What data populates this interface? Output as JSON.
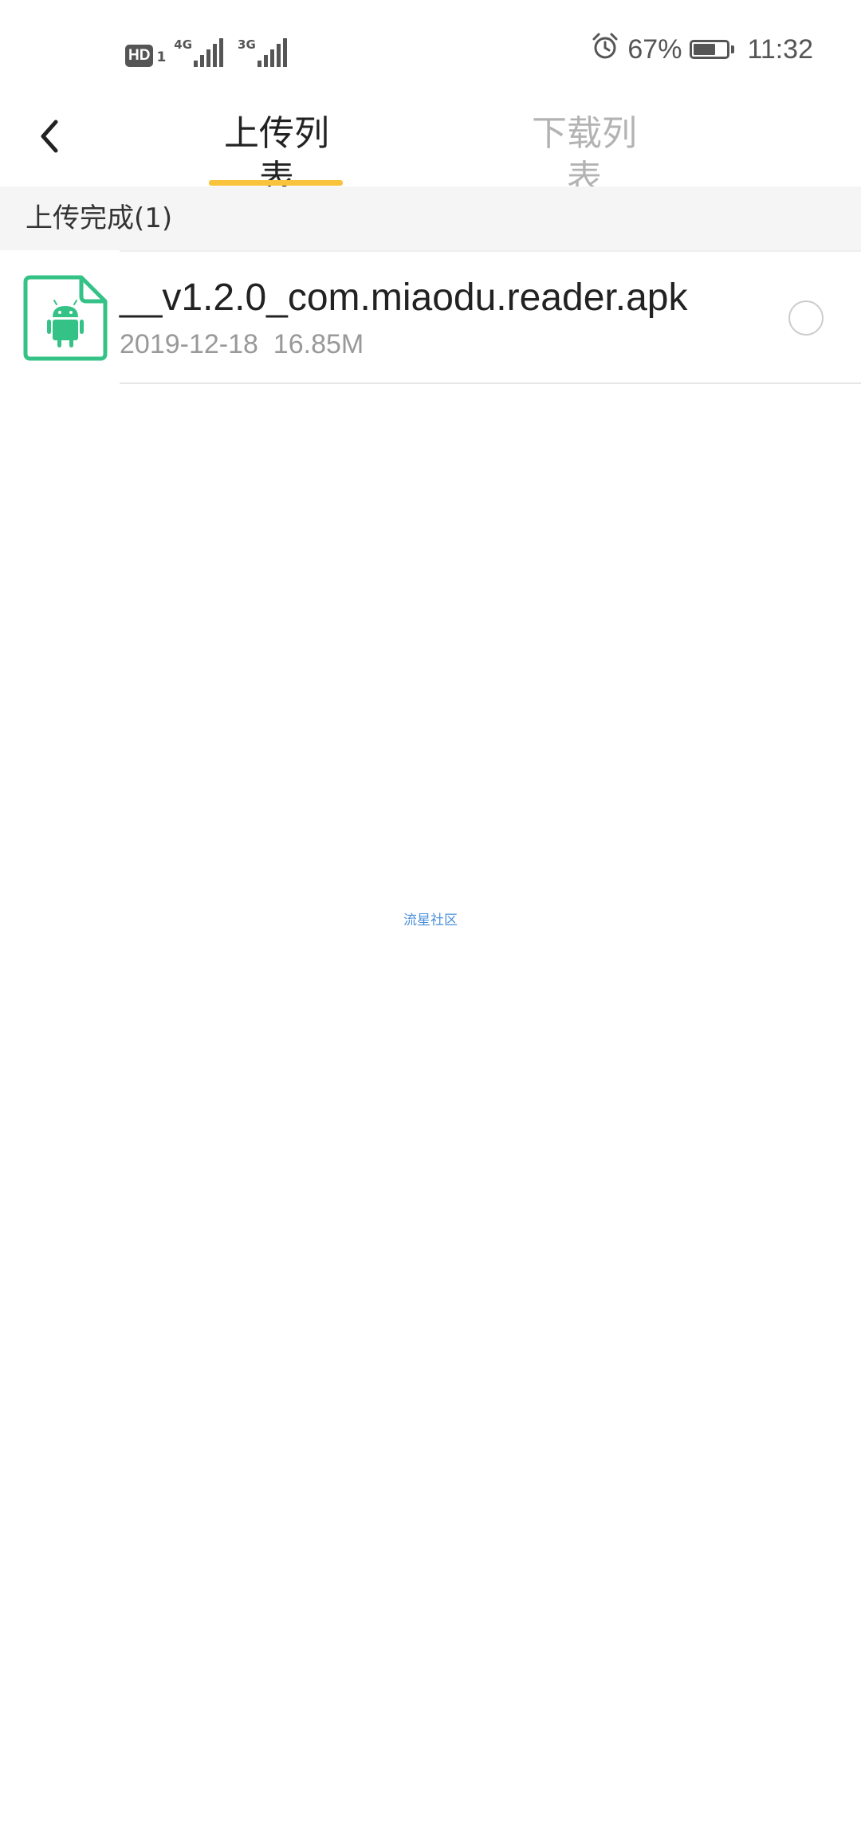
{
  "status_bar": {
    "hd_label": "HD",
    "hd_sub": "1",
    "network1": "4G",
    "network2": "3G",
    "battery_percent": "67%",
    "time": "11:32",
    "icons": [
      "hd-icon",
      "signal-4g-icon",
      "signal-3g-icon",
      "alarm-icon",
      "battery-icon"
    ]
  },
  "nav": {
    "back_icon": "chevron-left-icon",
    "tabs": [
      {
        "label": "上传列表",
        "active": true
      },
      {
        "label": "下载列表",
        "active": false
      }
    ],
    "accent_color": "#f9c43c"
  },
  "section": {
    "title": "上传完成(1)"
  },
  "files": [
    {
      "name": "__v1.2.0_com.miaodu.reader.apk",
      "meta": "2019-12-18  16.85M",
      "icon": "android-apk-icon",
      "icon_color": "#35c286",
      "selected": false
    }
  ],
  "watermark": "流星社区"
}
